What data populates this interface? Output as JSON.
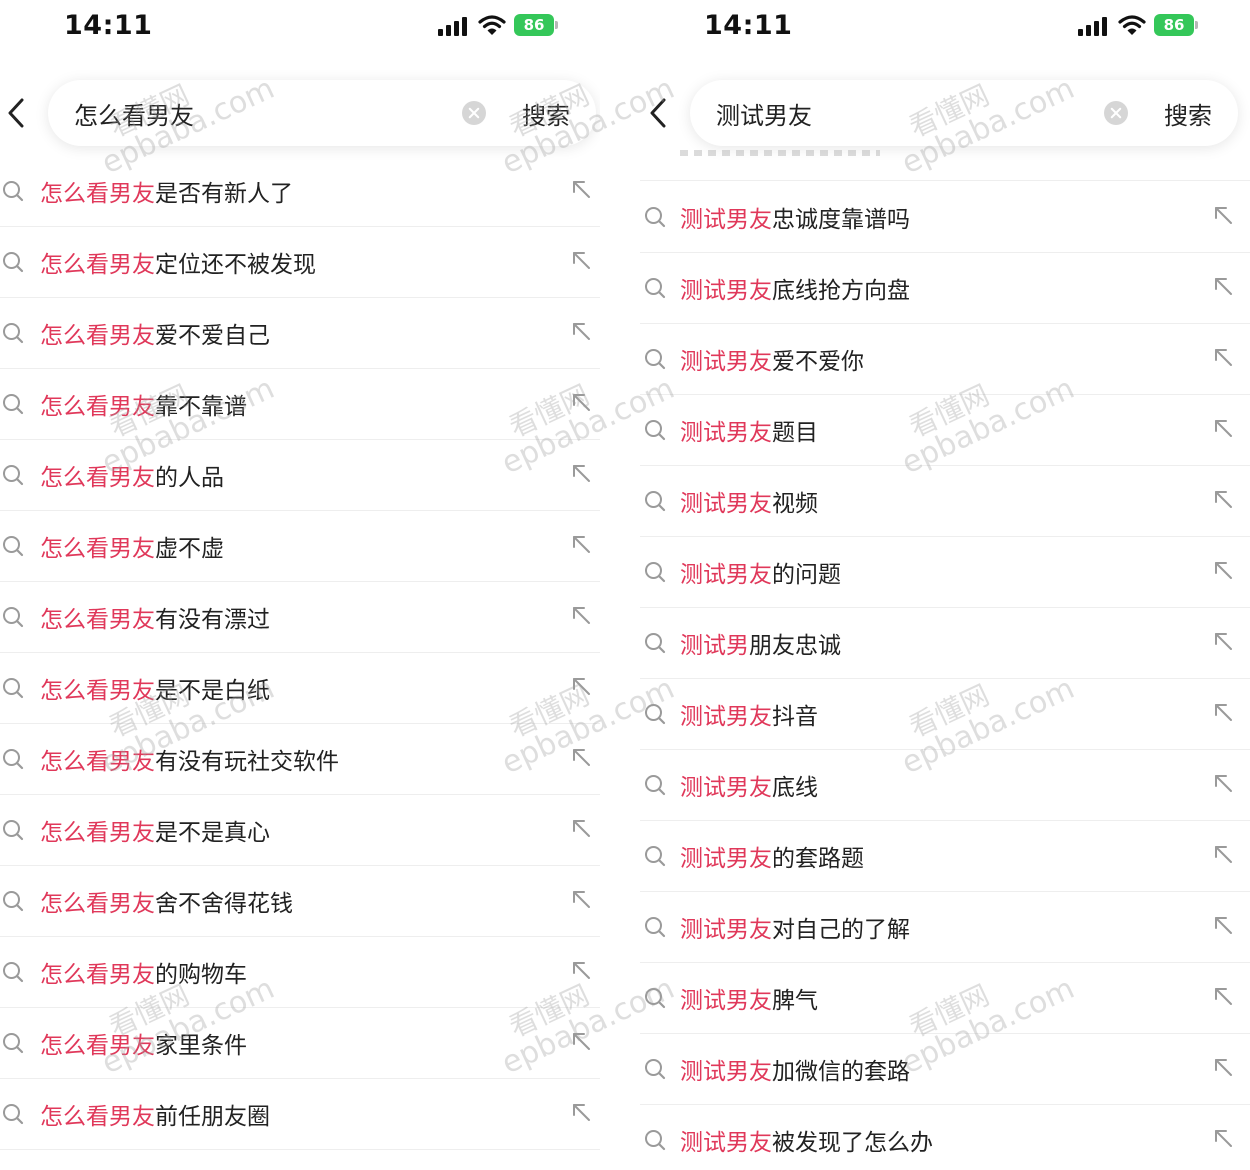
{
  "left_screen": {
    "status_bar": {
      "time": "14:11",
      "battery": "86"
    },
    "search": {
      "query": "怎么看男友",
      "search_label": "搜索"
    },
    "highlight_color": "#e0385a",
    "suggestions": [
      {
        "highlight": "怎么看男友",
        "rest": "是否有新人了"
      },
      {
        "highlight": "怎么看男友",
        "rest": "定位还不被发现"
      },
      {
        "highlight": "怎么看男友",
        "rest": "爱不爱自己"
      },
      {
        "highlight": "怎么看男友",
        "rest": "靠不靠谱"
      },
      {
        "highlight": "怎么看男友",
        "rest": "的人品"
      },
      {
        "highlight": "怎么看男友",
        "rest": "虚不虚"
      },
      {
        "highlight": "怎么看男友",
        "rest": "有没有漂过"
      },
      {
        "highlight": "怎么看男友",
        "rest": "是不是白纸"
      },
      {
        "highlight": "怎么看男友",
        "rest": "有没有玩社交软件"
      },
      {
        "highlight": "怎么看男友",
        "rest": "是不是真心"
      },
      {
        "highlight": "怎么看男友",
        "rest": "舍不舍得花钱"
      },
      {
        "highlight": "怎么看男友",
        "rest": "的购物车"
      },
      {
        "highlight": "怎么看男友",
        "rest": "家里条件"
      },
      {
        "highlight": "怎么看男友",
        "rest": "前任朋友圈"
      }
    ]
  },
  "right_screen": {
    "status_bar": {
      "time": "14:11",
      "battery": "86"
    },
    "search": {
      "query": "测试男友",
      "search_label": "搜索"
    },
    "highlight_color": "#e0385a",
    "suggestions": [
      {
        "highlight": "测试男友",
        "rest": "忠诚度靠谱吗"
      },
      {
        "highlight": "测试男友",
        "rest": "底线抢方向盘"
      },
      {
        "highlight": "测试男友",
        "rest": "爱不爱你"
      },
      {
        "highlight": "测试男友",
        "rest": "题目"
      },
      {
        "highlight": "测试男友",
        "rest": "视频"
      },
      {
        "highlight": "测试男友",
        "rest": "的问题"
      },
      {
        "highlight": "测试男",
        "rest": "朋友忠诚"
      },
      {
        "highlight": "测试男友",
        "rest": "抖音"
      },
      {
        "highlight": "测试男友",
        "rest": "底线"
      },
      {
        "highlight": "测试男友",
        "rest": "的套路题"
      },
      {
        "highlight": "测试男友",
        "rest": "对自己的了解"
      },
      {
        "highlight": "测试男友",
        "rest": "脾气"
      },
      {
        "highlight": "测试男友",
        "rest": "加微信的套路"
      },
      {
        "highlight": "测试男友",
        "rest": "被发现了怎么办"
      }
    ]
  },
  "watermark": {
    "cn": "看懂网",
    "en": "epbaba.com"
  }
}
